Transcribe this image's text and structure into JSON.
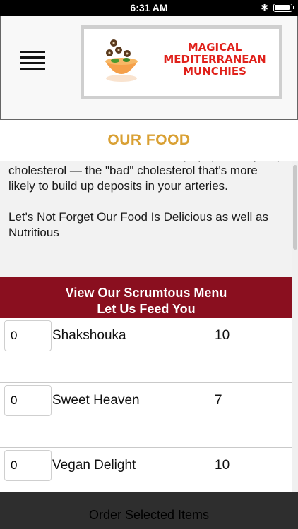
{
  "status_bar": {
    "time": "6:31 AM",
    "icons": [
      "bluetooth-icon",
      "battery-icon"
    ]
  },
  "header": {
    "menu_icon": "hamburger-menu-icon",
    "logo": {
      "line1": "MAGICAL",
      "line2": "MEDITERRANEAN",
      "line3": "MUNCHIES",
      "text_color": "#e0211b"
    }
  },
  "section": {
    "title": "OUR FOOD",
    "title_color": "#d9a033"
  },
  "article": {
    "paragraph1": "lower level of oxidized low-density lipoprotein (LDL) cholesterol — the \"bad\" cholesterol that's more likely to build up deposits in your arteries.",
    "paragraph2": "Let's Not Forget Our Food Is Delicious as well as Nutritious"
  },
  "menu_banner": {
    "line1": "View Our Scrumtous Menu",
    "line2": "Let Us Feed You",
    "background": "#8a0f1f"
  },
  "menu_items": [
    {
      "quantity": "0",
      "name": "Shakshouka",
      "price": "10"
    },
    {
      "quantity": "0",
      "name": "Sweet Heaven",
      "price": "7"
    },
    {
      "quantity": "0",
      "name": "Vegan Delight",
      "price": "10"
    }
  ],
  "order_button": {
    "label": "Order Selected Items"
  }
}
